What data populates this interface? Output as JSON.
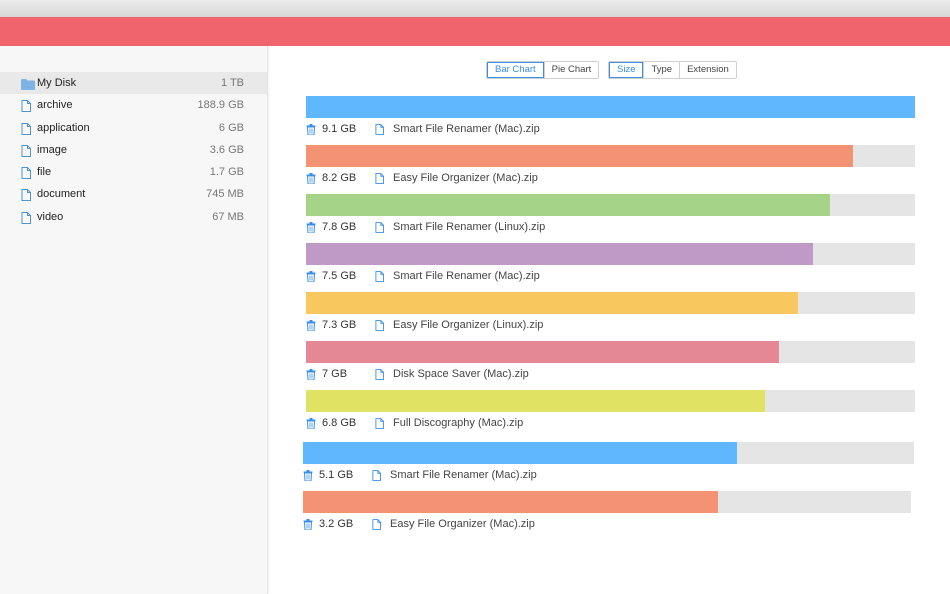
{
  "app": {
    "accent": "#f0646d",
    "link_color": "#3a8ee6"
  },
  "sidebar": {
    "items": [
      {
        "label": "My Disk",
        "size": "1 TB",
        "icon": "folder-icon",
        "active": true
      },
      {
        "label": "archive",
        "size": "188.9 GB",
        "icon": "file-icon",
        "active": false
      },
      {
        "label": "application",
        "size": "6 GB",
        "icon": "file-icon",
        "active": false
      },
      {
        "label": "image",
        "size": "3.6 GB",
        "icon": "file-icon",
        "active": false
      },
      {
        "label": "file",
        "size": "1.7 GB",
        "icon": "file-icon",
        "active": false
      },
      {
        "label": "document",
        "size": "745 MB",
        "icon": "file-icon",
        "active": false
      },
      {
        "label": "video",
        "size": "67 MB",
        "icon": "file-icon",
        "active": false
      }
    ]
  },
  "toolbar": {
    "chart_modes": [
      {
        "label": "Bar Chart",
        "selected": true
      },
      {
        "label": "Pie Chart",
        "selected": false
      }
    ],
    "sort_modes": [
      {
        "label": "Size",
        "selected": true
      },
      {
        "label": "Type",
        "selected": false
      },
      {
        "label": "Extension",
        "selected": false
      }
    ]
  },
  "files": [
    {
      "size": "9.1 GB",
      "name": "Smart File Renamer (Mac).zip",
      "fraction": 1.0,
      "color": "#5fb8fd"
    },
    {
      "size": "8.2 GB",
      "name": "Easy File Organizer (Mac).zip",
      "fraction": 0.899,
      "color": "#f49374"
    },
    {
      "size": "7.8 GB",
      "name": "Smart File Renamer (Linux).zip",
      "fraction": 0.861,
      "color": "#a5d387"
    },
    {
      "size": "7.5 GB",
      "name": "Smart File Renamer (Mac).zip",
      "fraction": 0.833,
      "color": "#c09ac6"
    },
    {
      "size": "7.3 GB",
      "name": "Easy File Organizer (Linux).zip",
      "fraction": 0.808,
      "color": "#f8c85e"
    },
    {
      "size": "7 GB",
      "name": "Disk Space Saver (Mac).zip",
      "fraction": 0.776,
      "color": "#e58895"
    },
    {
      "size": "6.8 GB",
      "name": "Full Discography (Mac).zip",
      "fraction": 0.754,
      "color": "#e0e264"
    },
    {
      "size": "5.1 GB",
      "name": "Smart File Renamer (Mac).zip",
      "fraction": 0.71,
      "color": "#5fb8fd"
    },
    {
      "size": "3.2 GB",
      "name": "Easy File Organizer (Mac).zip",
      "fraction": 0.682,
      "color": "#f49374"
    }
  ]
}
